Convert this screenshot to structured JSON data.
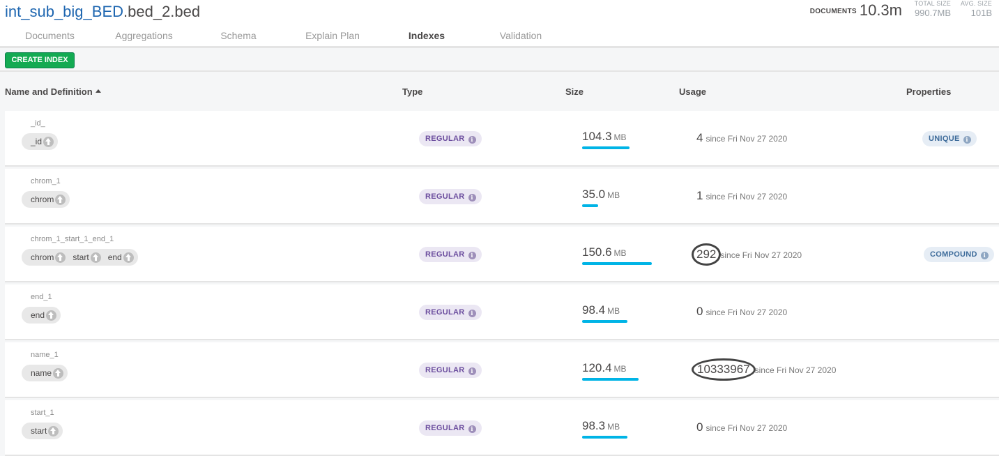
{
  "header": {
    "db_name": "int_sub_big_BED",
    "collection_name": ".bed_2.bed",
    "documents_label": "DOCUMENTS",
    "documents_value": "10.3m",
    "total_size_label": "TOTAL SIZE",
    "total_size_value": "990.7MB",
    "avg_size_label": "AVG. SIZE",
    "avg_size_value": "101B"
  },
  "tabs": [
    {
      "label": "Documents"
    },
    {
      "label": "Aggregations"
    },
    {
      "label": "Schema"
    },
    {
      "label": "Explain Plan"
    },
    {
      "label": "Indexes",
      "active": true
    },
    {
      "label": "Validation"
    }
  ],
  "toolbar": {
    "create_index_label": "CREATE INDEX"
  },
  "columns": {
    "name": "Name and Definition",
    "type": "Type",
    "size": "Size",
    "usage": "Usage",
    "properties": "Properties"
  },
  "indexes": [
    {
      "name": "_id_",
      "fields": [
        "_id"
      ],
      "type": "REGULAR",
      "size": "104.3",
      "size_unit": "MB",
      "size_fraction": 0.45,
      "usage": "4",
      "since": "since Fri Nov 27 2020",
      "property": "UNIQUE"
    },
    {
      "name": "chrom_1",
      "fields": [
        "chrom"
      ],
      "type": "REGULAR",
      "size": "35.0",
      "size_unit": "MB",
      "size_fraction": 0.15,
      "usage": "1",
      "since": "since Fri Nov 27 2020",
      "property": ""
    },
    {
      "name": "chrom_1_start_1_end_1",
      "fields": [
        "chrom",
        "start",
        "end"
      ],
      "type": "REGULAR",
      "size": "150.6",
      "size_unit": "MB",
      "size_fraction": 0.66,
      "usage": "292",
      "since": "since Fri Nov 27 2020",
      "property": "COMPOUND"
    },
    {
      "name": "end_1",
      "fields": [
        "end"
      ],
      "type": "REGULAR",
      "size": "98.4",
      "size_unit": "MB",
      "size_fraction": 0.43,
      "usage": "0",
      "since": "since Fri Nov 27 2020",
      "property": ""
    },
    {
      "name": "name_1",
      "fields": [
        "name"
      ],
      "type": "REGULAR",
      "size": "120.4",
      "size_unit": "MB",
      "size_fraction": 0.53,
      "usage": "10333967",
      "since": "since Fri Nov 27 2020",
      "property": ""
    },
    {
      "name": "start_1",
      "fields": [
        "start"
      ],
      "type": "REGULAR",
      "size": "98.3",
      "size_unit": "MB",
      "size_fraction": 0.43,
      "usage": "0",
      "since": "since Fri Nov 27 2020",
      "property": ""
    }
  ],
  "icons": {
    "sort": "sort-asc-icon",
    "field_direction": "arrow-up-circle-icon",
    "info": "info-icon"
  },
  "colors": {
    "accent_green": "#13aa52",
    "size_bar": "#00b4e6",
    "db_name": "#1e66b0"
  }
}
